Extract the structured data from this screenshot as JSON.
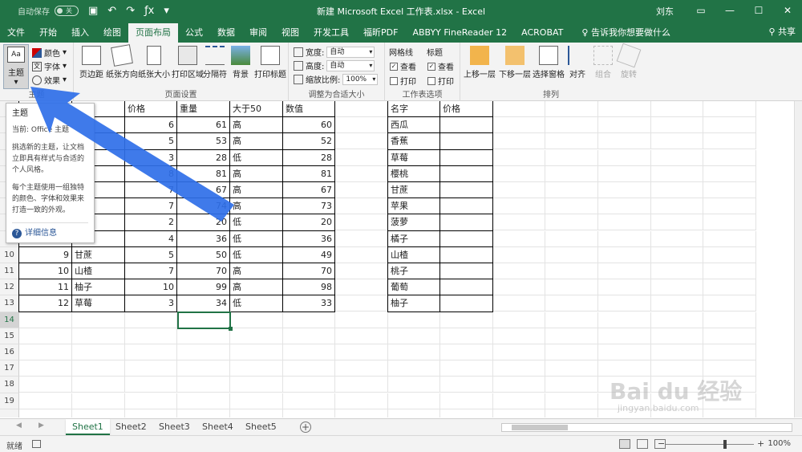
{
  "titlebar": {
    "autosave": "自动保存",
    "autosave_state": "关",
    "doc_title": "新建 Microsoft Excel 工作表.xlsx - Excel",
    "user": "刘东"
  },
  "tabs": [
    "文件",
    "开始",
    "插入",
    "绘图",
    "页面布局",
    "公式",
    "数据",
    "审阅",
    "视图",
    "开发工具",
    "福昕PDF",
    "ABBYY FineReader 12",
    "ACROBAT"
  ],
  "active_tab": "页面布局",
  "tellme": "告诉我你想要做什么",
  "share": "共享",
  "ribbon": {
    "theme": "主题",
    "colors": "颜色",
    "fonts": "字体",
    "effects": "效果",
    "margins": "页边距",
    "orientation": "纸张方向",
    "size": "纸张大小",
    "print_area": "打印区域",
    "breaks": "分隔符",
    "background": "背景",
    "print_titles": "打印标题",
    "page_setup_label": "页面设置",
    "width_label": "宽度:",
    "width_value": "自动",
    "height_label": "高度:",
    "height_value": "自动",
    "scale_label": "缩放比例:",
    "scale_value": "100%",
    "scale_group_label": "调整为合适大小",
    "gridlines": "网格线",
    "headings": "标题",
    "view": "查看",
    "print": "打印",
    "sheet_options_label": "工作表选项",
    "bring_forward": "上移一层",
    "send_backward": "下移一层",
    "selection_pane": "选择窗格",
    "align": "对齐",
    "group": "组合",
    "rotate": "旋转",
    "arrange_label": "排列",
    "theme_group_label": "主题"
  },
  "tooltip": {
    "title": "主题",
    "current": "当前: Office 主题",
    "desc1": "挑选新的主题，让文档立即具有样式与合适的个人风格。",
    "desc2": "每个主题使用一组独特的颜色、字体和效果来打造一致的外观。",
    "more": "详细信息"
  },
  "table1": {
    "headers": [
      "价格",
      "重量",
      "大于50",
      "数值"
    ],
    "rows": [
      {
        "price": "6",
        "weight": "61",
        "gt50": "高",
        "value": "60"
      },
      {
        "price": "5",
        "weight": "53",
        "gt50": "高",
        "value": "52"
      },
      {
        "price": "3",
        "weight": "28",
        "gt50": "低",
        "value": "28"
      },
      {
        "price": "8",
        "weight": "81",
        "gt50": "高",
        "value": "81"
      },
      {
        "price": "7",
        "weight": "67",
        "gt50": "高",
        "value": "67"
      },
      {
        "price": "7",
        "weight": "74",
        "gt50": "高",
        "value": "73"
      },
      {
        "price": "2",
        "weight": "20",
        "gt50": "低",
        "value": "20"
      },
      {
        "price": "4",
        "weight": "36",
        "gt50": "低",
        "value": "36"
      },
      {
        "id": "9",
        "name": "甘蔗",
        "price": "5",
        "weight": "50",
        "gt50": "低",
        "value": "49"
      },
      {
        "id": "10",
        "name": "山楂",
        "price": "7",
        "weight": "70",
        "gt50": "高",
        "value": "70"
      },
      {
        "id": "11",
        "name": "柚子",
        "price": "10",
        "weight": "99",
        "gt50": "高",
        "value": "98"
      },
      {
        "id": "12",
        "name": "草莓",
        "price": "3",
        "weight": "34",
        "gt50": "低",
        "value": "33"
      }
    ]
  },
  "table2": {
    "headers": [
      "名字",
      "价格"
    ],
    "names": [
      "西瓜",
      "香蕉",
      "草莓",
      "樱桃",
      "甘蔗",
      "苹果",
      "菠萝",
      "橘子",
      "山楂",
      "桃子",
      "葡萄",
      "柚子"
    ]
  },
  "row_numbers": [
    "10",
    "11",
    "12",
    "13",
    "14",
    "15",
    "16",
    "17",
    "18",
    "19"
  ],
  "sheets": [
    "Sheet1",
    "Sheet2",
    "Sheet3",
    "Sheet4",
    "Sheet5"
  ],
  "active_sheet": "Sheet1",
  "status": {
    "ready": "就绪",
    "zoom": "100%"
  },
  "watermark": {
    "line1": "Bai du 经验",
    "line2": "jingyan.baidu.com"
  },
  "colors": {
    "excel_green": "#217346",
    "arrow_blue": "#2f6fe8"
  }
}
